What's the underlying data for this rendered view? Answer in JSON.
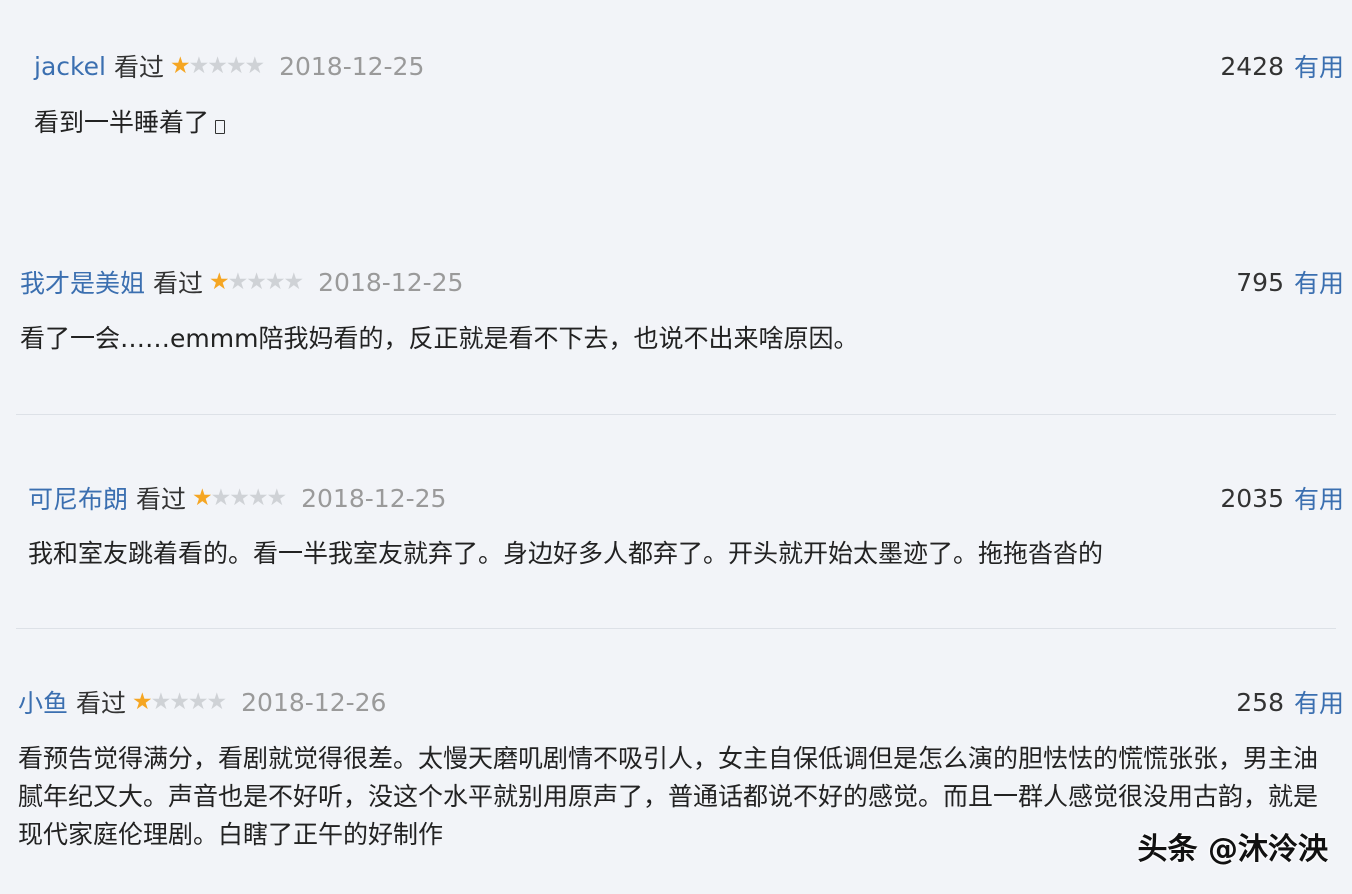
{
  "reviews": [
    {
      "user": "jackel",
      "status": "看过",
      "rating": 1,
      "date": "2018-12-25",
      "useful_count": "2428",
      "useful_label": "有用",
      "text": "看到一半睡着了"
    },
    {
      "user": "我才是美姐",
      "status": "看过",
      "rating": 1,
      "date": "2018-12-25",
      "useful_count": "795",
      "useful_label": "有用",
      "text": "看了一会……emmm陪我妈看的，反正就是看不下去，也说不出来啥原因。"
    },
    {
      "user": "可尼布朗",
      "status": "看过",
      "rating": 1,
      "date": "2018-12-25",
      "useful_count": "2035",
      "useful_label": "有用",
      "text": "我和室友跳着看的。看一半我室友就弃了。身边好多人都弃了。开头就开始太墨迹了。拖拖沓沓的"
    },
    {
      "user": "小鱼",
      "status": "看过",
      "rating": 1,
      "date": "2018-12-26",
      "useful_count": "258",
      "useful_label": "有用",
      "text": "看预告觉得满分，看剧就觉得很差。太慢天磨叽剧情不吸引人，女主自保低调但是怎么演的胆怯怯的慌慌张张，男主油腻年纪又大。声音也是不好听，没这个水平就别用原声了，普通话都说不好的感觉。而且一群人感觉很没用古韵，就是现代家庭伦理剧。白瞎了正午的好制作"
    }
  ],
  "colors": {
    "username": "#3b6fb0",
    "star_on": "#f5a623",
    "star_off": "#cfd2d6",
    "date": "#9a9a9a",
    "background": "#f2f4f8"
  },
  "icons": [
    "star-icon",
    "phone-icon"
  ],
  "watermark": "头条 @沐泠泱"
}
